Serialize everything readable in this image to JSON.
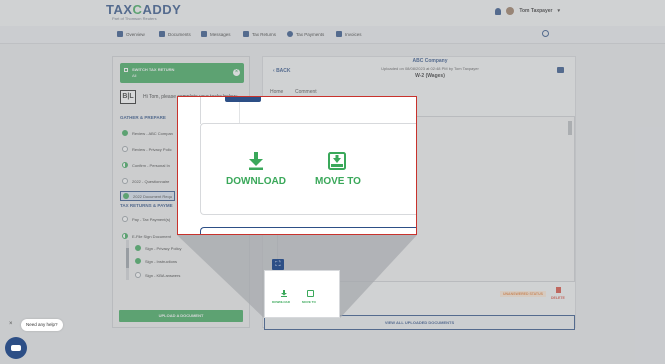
{
  "brand": {
    "name_main": "TAX",
    "name_x": "C",
    "name_rest": "ADDY",
    "tagline": "Part of Thomson Reuters"
  },
  "user": {
    "name": "Tom Taxpayer"
  },
  "nav": {
    "items": [
      {
        "label": "Overview",
        "icon": "home-icon"
      },
      {
        "label": "Documents",
        "icon": "documents-icon"
      },
      {
        "label": "Messages",
        "icon": "messages-icon"
      },
      {
        "label": "Tax Returns",
        "icon": "tax-returns-icon"
      },
      {
        "label": "Tax Payments",
        "icon": "dollar-icon"
      },
      {
        "label": "Invoices",
        "icon": "invoice-icon"
      }
    ]
  },
  "left_panel": {
    "switch_label": "SWITCH TAX RETURN",
    "switch_sub": "All",
    "bl_logo": "B|L",
    "greeting": "Hi Tom, please complete your tasks below:",
    "gather_heading": "GATHER & PREPARE",
    "gather_tasks": [
      {
        "label": "Review - ABC Compan",
        "state": "done"
      },
      {
        "label": "Review - Privacy Polic",
        "state": "empty"
      },
      {
        "label": "Confirm - Personal In",
        "state": "half"
      },
      {
        "label": "2022 - Questionnaire",
        "state": "empty"
      },
      {
        "label": "2022 Document Requ",
        "state": "done"
      }
    ],
    "returns_heading": "TAX RETURNS & PAYME",
    "return_tasks": [
      {
        "label": "Pay - Tax Payment(s)",
        "state": "empty"
      },
      {
        "label": "E-File Sign Document",
        "state": "half"
      },
      {
        "label": "Sign - Privacy Policy",
        "state": "done"
      },
      {
        "label": "Sign - Instructions",
        "state": "done"
      },
      {
        "label": "Sign - KBA answers",
        "state": "empty"
      }
    ],
    "upload_label": "UPLOAD A DOCUMENT"
  },
  "document": {
    "back_label": "BACK",
    "company": "ABC Company",
    "uploaded": "Uploaded on 08/08/2023 at 02:48 PM by Tom Taxpayer",
    "name": "W-2 (Wages)",
    "tabs": [
      "Home",
      "Comment"
    ],
    "status": "UNANSWERED STATUS",
    "delete_label": "DELETE",
    "view_all_label": "VIEW ALL UPLOADED DOCUMENTS"
  },
  "actions": {
    "download_label": "DOWNLOAD",
    "move_to_label": "MOVE TO"
  },
  "chat": {
    "prompt": "Need any help?",
    "close": "×"
  },
  "colors": {
    "brand_blue": "#2d4f86",
    "brand_green": "#3aa85a",
    "highlight_red": "#c8322c",
    "status_orange": "#e8833a"
  }
}
